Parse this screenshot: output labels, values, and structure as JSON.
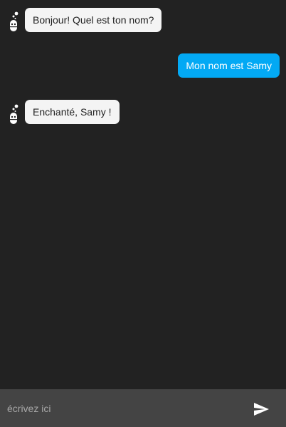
{
  "conversation": {
    "messages": [
      {
        "sender": "bot",
        "text": "Bonjour! Quel est ton nom?"
      },
      {
        "sender": "user",
        "text": "Mon nom est Samy"
      },
      {
        "sender": "bot",
        "text": "Enchanté, Samy !"
      }
    ]
  },
  "composer": {
    "placeholder": "écrivez ici",
    "value": "",
    "send_icon": "send-icon"
  },
  "colors": {
    "background": "#222222",
    "bot_bubble": "#f4f4f4",
    "user_bubble": "#03a9f4",
    "composer_bg": "#444444"
  }
}
